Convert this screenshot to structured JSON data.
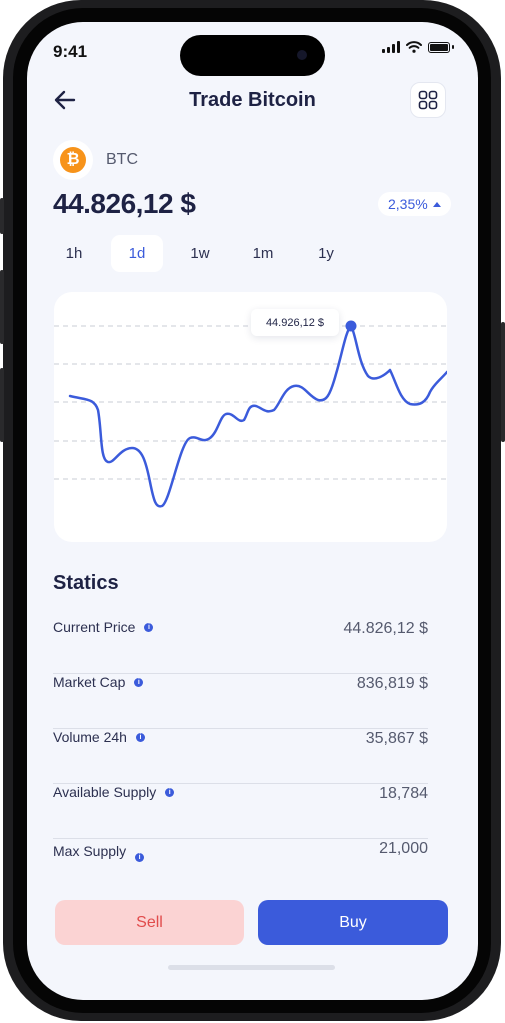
{
  "status": {
    "time": "9:41"
  },
  "header": {
    "title": "Trade Bitcoin",
    "back_icon": "arrow-left-icon",
    "menu_icon": "grid-icon"
  },
  "coin": {
    "symbol": "BTC",
    "icon_glyph": "₿",
    "icon_color": "#f7931a",
    "price": "44.826,12 $",
    "change": "2,35%",
    "change_color": "#3b5bdb"
  },
  "tabs": [
    {
      "label": "1h",
      "active": false
    },
    {
      "label": "1d",
      "active": true
    },
    {
      "label": "1w",
      "active": false
    },
    {
      "label": "1m",
      "active": false
    },
    {
      "label": "1y",
      "active": false
    }
  ],
  "chart": {
    "tooltip": "44.926,12 $",
    "line_color": "#3b5bdb"
  },
  "statics": {
    "title": "Statics",
    "rows": [
      {
        "label": "Current Price",
        "value": "44.826,12 $"
      },
      {
        "label": "Market Cap",
        "value": "836,819 $"
      },
      {
        "label": "Volume 24h",
        "value": "35,867 $"
      },
      {
        "label": "Available Supply",
        "value": "18,784"
      },
      {
        "label": "Max Supply",
        "value": "21,000"
      }
    ]
  },
  "actions": {
    "sell": "Sell",
    "buy": "Buy",
    "sell_color": "#e14b4b",
    "buy_color": "#3b5bdb"
  }
}
